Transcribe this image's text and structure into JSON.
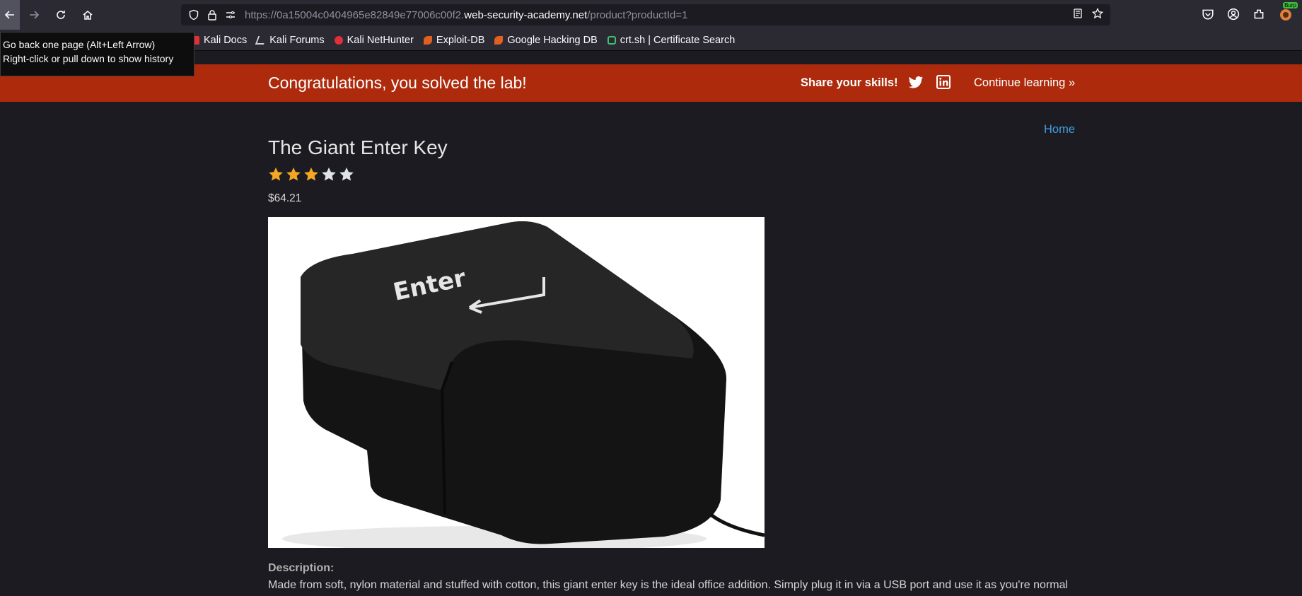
{
  "browser": {
    "url_prefix": "https://0a15004c0404965e82849e77006c00f2.",
    "url_host": "web-security-academy.net",
    "url_path": "/product?productId=1",
    "tooltip_line1": "Go back one page (Alt+Left Arrow)",
    "tooltip_line2": "Right-click or pull down to show history",
    "burp_badge": "Burp",
    "bookmarks": [
      {
        "label": "Kali Docs",
        "icon": "kali-docs-icon",
        "color": "#e0303a"
      },
      {
        "label": "Kali Forums",
        "icon": "kali-forums-icon",
        "color": "#cfcfd8"
      },
      {
        "label": "Kali NetHunter",
        "icon": "nethunter-icon",
        "color": "#e0303a"
      },
      {
        "label": "Exploit-DB",
        "icon": "exploit-db-icon",
        "color": "#e06020"
      },
      {
        "label": "Google Hacking DB",
        "icon": "ghdb-icon",
        "color": "#e06020"
      },
      {
        "label": "crt.sh | Certificate Search",
        "icon": "crtsh-icon",
        "color": "#3fbf6f"
      }
    ]
  },
  "banner": {
    "title": "Congratulations, you solved the lab!",
    "share_label": "Share your skills!",
    "continue_label": "Continue learning",
    "background": "#ae2a0c"
  },
  "page": {
    "home_link": "Home",
    "product_title": "The Giant Enter Key",
    "rating": 3,
    "rating_max": 5,
    "price": "$64.21",
    "image_key_label": "Enter",
    "description_label": "Description:",
    "description_text": "Made from soft, nylon material and stuffed with cotton, this giant enter key is the ideal office addition. Simply plug it in via a USB port and use it as you're normal"
  }
}
